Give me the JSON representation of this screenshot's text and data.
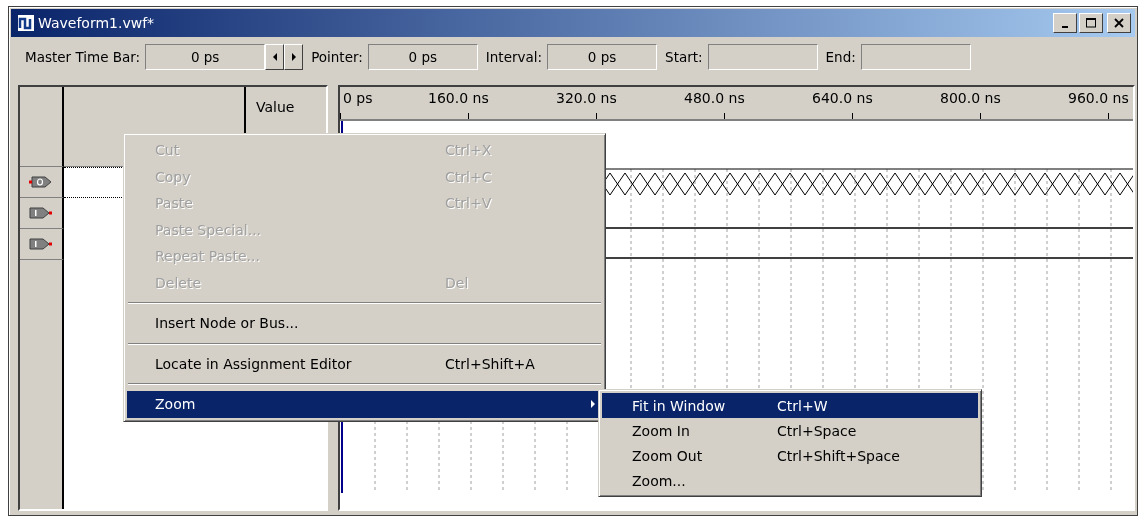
{
  "window": {
    "title": "Waveform1.vwf*"
  },
  "toolbar": {
    "fields": [
      {
        "label": "Master Time Bar:",
        "value": "0 ps",
        "arrows": true
      },
      {
        "label": "Pointer:",
        "value": "0 ps",
        "arrows": false
      },
      {
        "label": "Interval:",
        "value": "0 ps",
        "arrows": false
      },
      {
        "label": "Start:",
        "arrows": false
      },
      {
        "label": "End:",
        "arrows": false
      }
    ]
  },
  "node_table": {
    "value_header": "Value",
    "nodes": [
      {
        "kind": "output",
        "selected": true
      },
      {
        "kind": "input",
        "selected": false
      },
      {
        "kind": "input",
        "selected": false
      }
    ]
  },
  "waveform": {
    "ruler_labels": [
      "0 ps",
      "160.0 ns",
      "320.0 ns",
      "480.0 ns",
      "640.0 ns",
      "800.0 ns",
      "960.0 ns"
    ],
    "signals": [
      {
        "kind": "bus"
      },
      {
        "kind": "low"
      },
      {
        "kind": "low"
      }
    ]
  },
  "context_menu": {
    "items": [
      {
        "kind": "item",
        "label": "Cut",
        "shortcut": "Ctrl+X",
        "disabled": true,
        "selected": false
      },
      {
        "kind": "item",
        "label": "Copy",
        "shortcut": "Ctrl+C",
        "disabled": true,
        "selected": false
      },
      {
        "kind": "item",
        "label": "Paste",
        "shortcut": "Ctrl+V",
        "disabled": true,
        "selected": false
      },
      {
        "kind": "item",
        "label": "Paste Special...",
        "disabled": true,
        "selected": false
      },
      {
        "kind": "item",
        "label": "Repeat Paste...",
        "disabled": true,
        "selected": false
      },
      {
        "kind": "item",
        "label": "Delete",
        "shortcut": "Del",
        "disabled": true,
        "selected": false
      },
      {
        "kind": "separator"
      },
      {
        "kind": "item",
        "label": "Insert Node or Bus...",
        "disabled": false,
        "selected": false
      },
      {
        "kind": "separator"
      },
      {
        "kind": "item",
        "label": "Locate in Assignment Editor",
        "shortcut": "Ctrl+Shift+A",
        "disabled": false,
        "selected": false
      },
      {
        "kind": "separator"
      },
      {
        "kind": "submenu",
        "label": "Zoom",
        "disabled": false,
        "selected": true
      }
    ]
  },
  "submenu": {
    "items": [
      {
        "label": "Fit in Window",
        "shortcut": "Ctrl+W",
        "selected": true
      },
      {
        "label": "Zoom In",
        "shortcut": "Ctrl+Space",
        "selected": false
      },
      {
        "label": "Zoom Out",
        "shortcut": "Ctrl+Shift+Space",
        "selected": false
      },
      {
        "label": "Zoom...",
        "selected": false
      }
    ]
  }
}
